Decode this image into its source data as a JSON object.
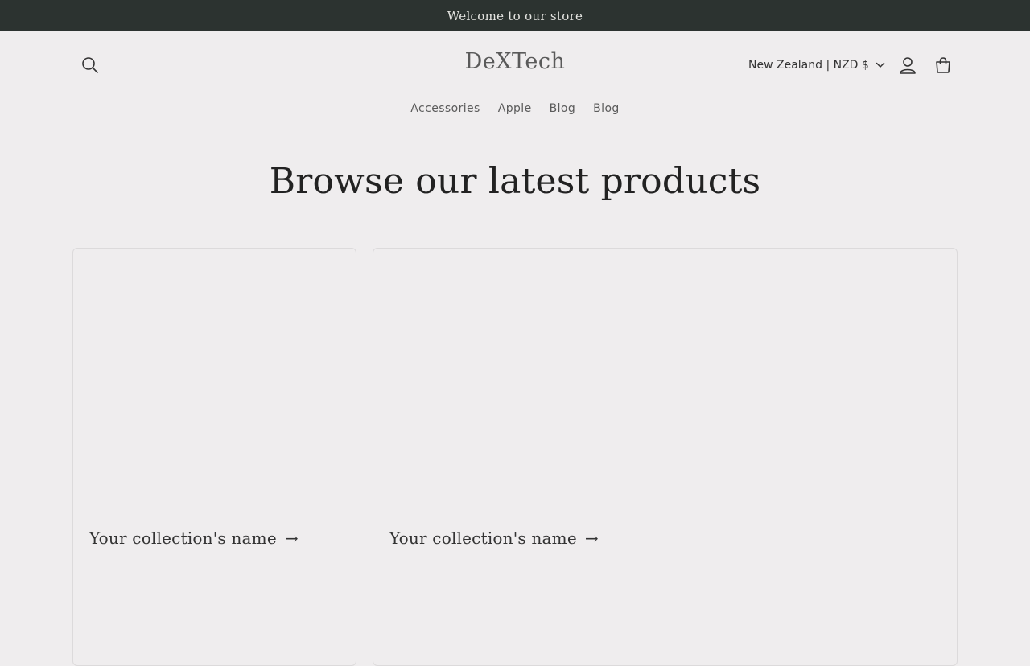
{
  "announcement": {
    "text": "Welcome to our store"
  },
  "header": {
    "logo": "DeXTech",
    "country_selector": "New Zealand | NZD $",
    "icons": {
      "search": "search-icon",
      "account": "account-icon",
      "cart": "cart-icon",
      "dropdown": "chevron-down-icon"
    }
  },
  "nav": {
    "items": [
      {
        "label": "Accessories"
      },
      {
        "label": "Apple"
      },
      {
        "label": "Blog"
      },
      {
        "label": "Blog"
      }
    ]
  },
  "main": {
    "heading": "Browse our latest products",
    "collections": [
      {
        "title": "Your collection's name",
        "arrow": "→"
      },
      {
        "title": "Your collection's name",
        "arrow": "→"
      }
    ]
  },
  "colors": {
    "background": "#efedee",
    "announcement_bg": "#2c3330",
    "text": "#2a2a2a"
  }
}
